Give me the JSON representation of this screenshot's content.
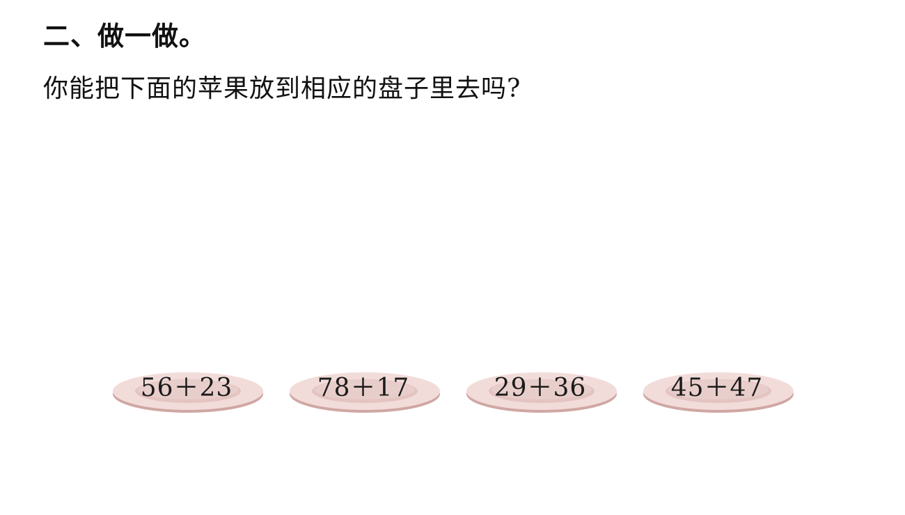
{
  "slide": {
    "heading": "二、做一做。",
    "question": "你能把下面的苹果放到相应的盘子里去吗?"
  },
  "plates": [
    {
      "expression": "56＋23"
    },
    {
      "expression": "78＋17"
    },
    {
      "expression": "29＋36"
    },
    {
      "expression": "45＋47"
    }
  ],
  "colors": {
    "plate_rim": "#edd2cf",
    "plate_inner": "#e3c4c1",
    "plate_shadow": "#cfa7a3",
    "text": "#111111"
  }
}
